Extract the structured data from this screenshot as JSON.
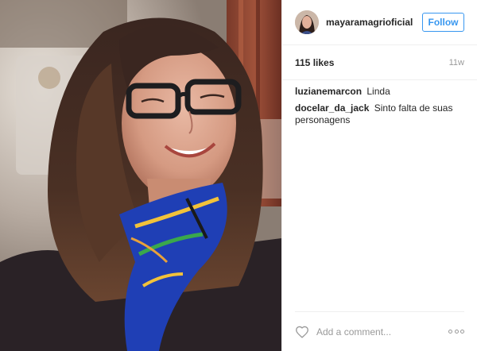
{
  "post": {
    "username": "mayaramagrioficial",
    "follow_label": "Follow",
    "likes": "115 likes",
    "time_ago": "11w",
    "comments": [
      {
        "author": "luzianemarcon",
        "text": "Linda"
      },
      {
        "author": "docelar_da_jack",
        "text": "Sinto falta de suas personagens"
      }
    ],
    "add_comment_placeholder": "Add a comment..."
  },
  "colors": {
    "accent": "#3897f0",
    "text": "#262626",
    "muted": "#999999",
    "divider": "#efefef"
  },
  "icons": {
    "like": "heart-outline-icon",
    "more": "more-options-icon"
  }
}
